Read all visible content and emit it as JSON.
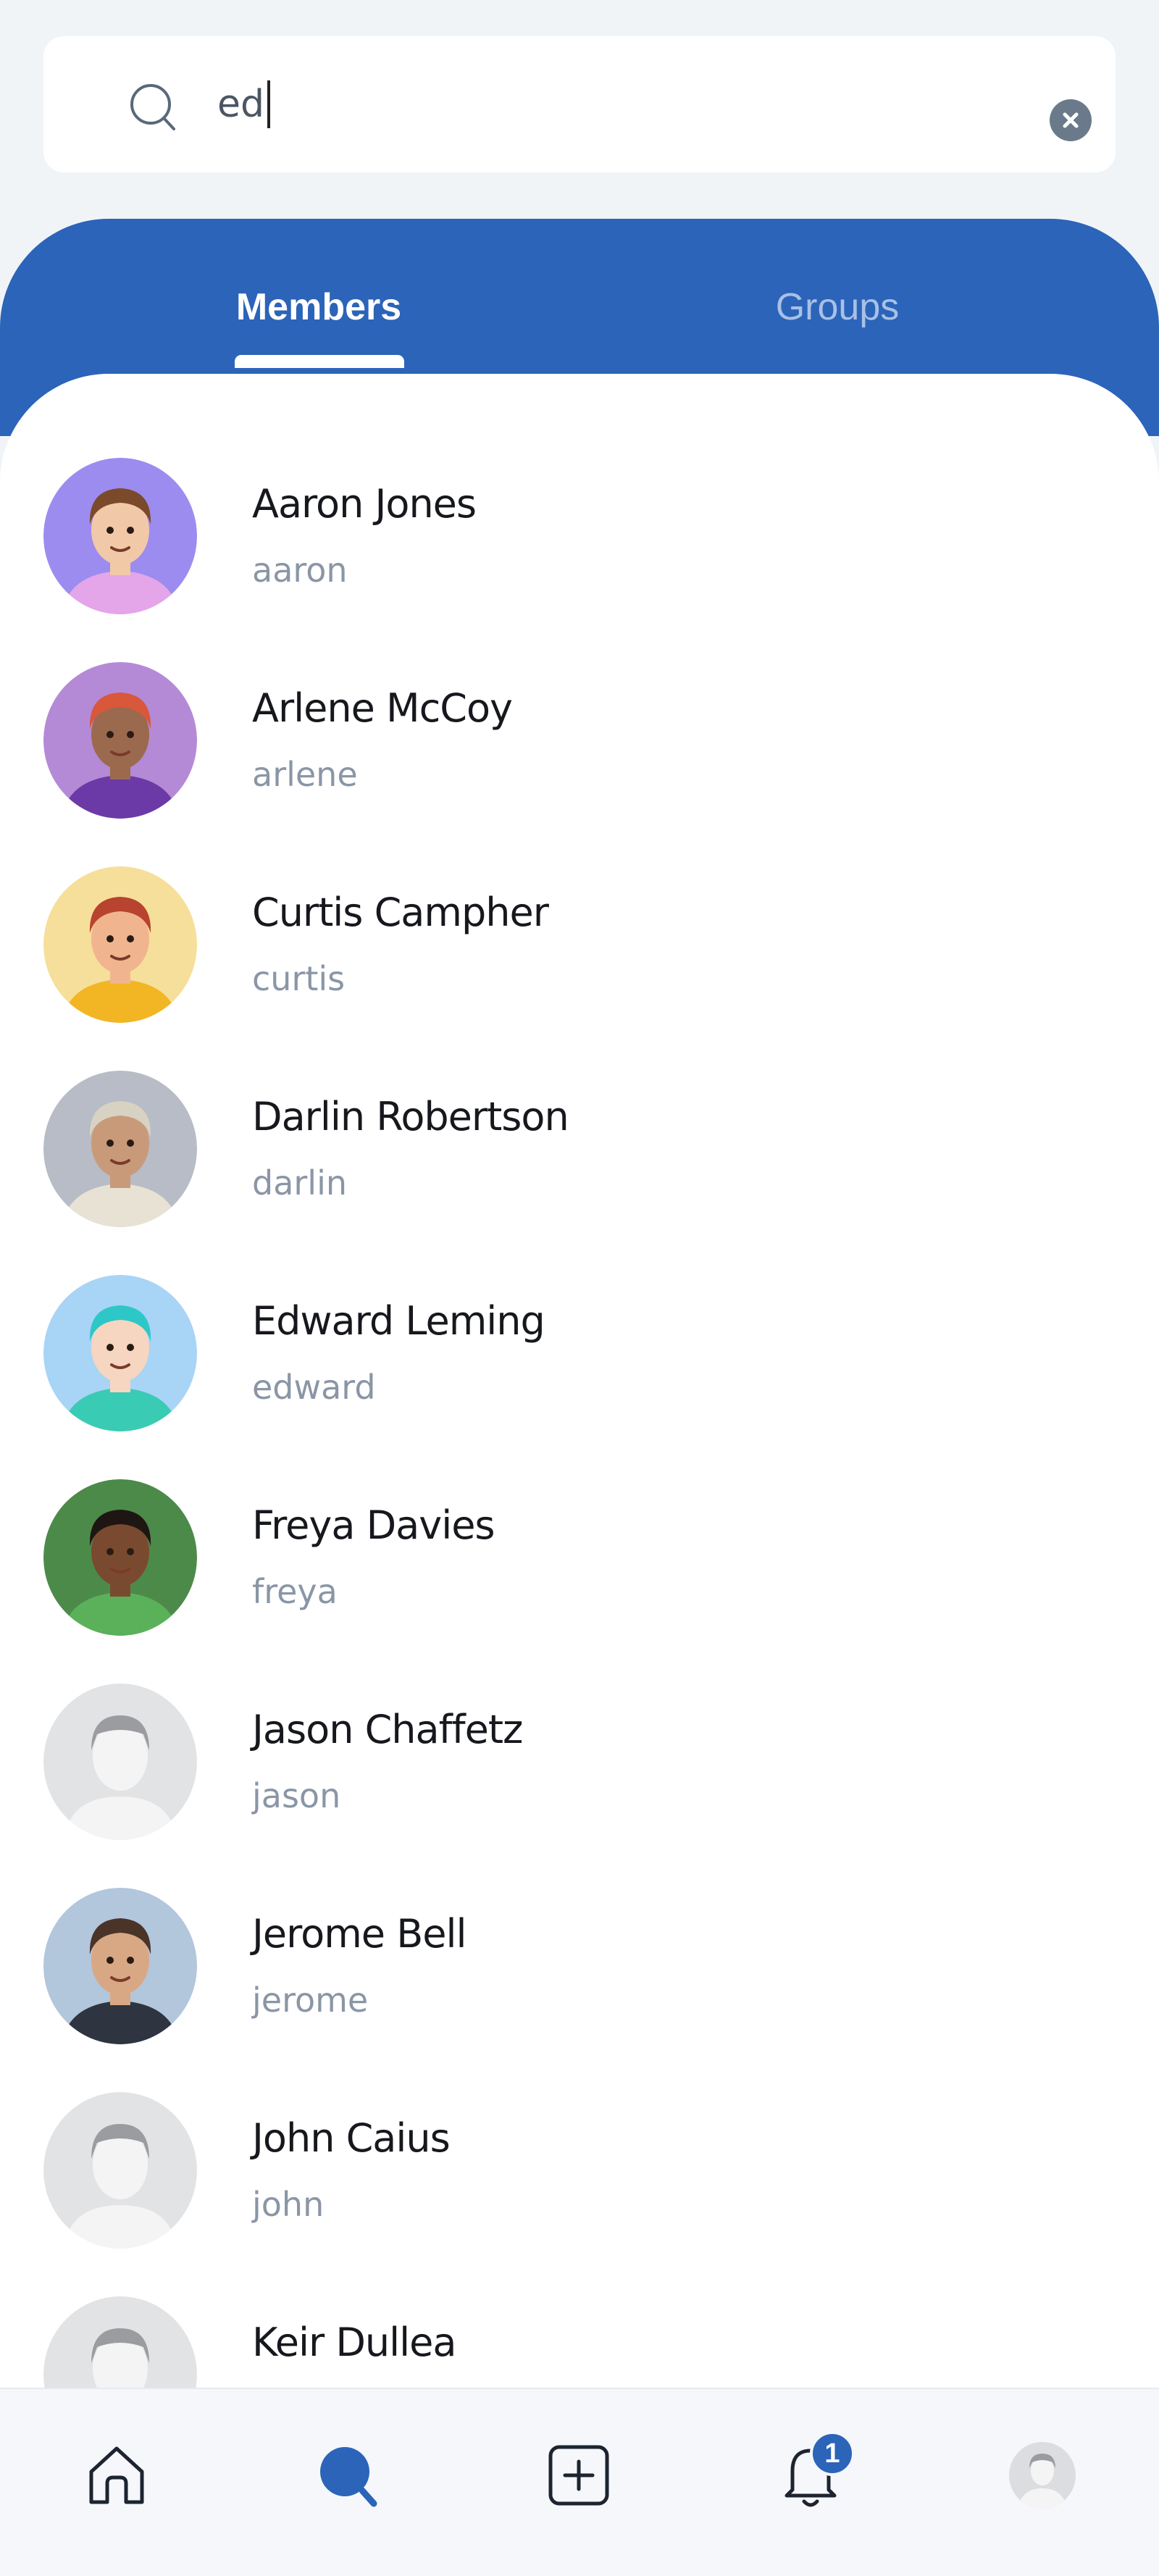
{
  "search": {
    "value": "ed",
    "clear_label": "clear search"
  },
  "tabs": [
    {
      "label": "Members",
      "active": true
    },
    {
      "label": "Groups",
      "active": false
    }
  ],
  "members": [
    {
      "name": "Aaron Jones",
      "username": "aaron",
      "avatar": "cartoon-boy-pink-hoodie",
      "bg": "#9c8cf0"
    },
    {
      "name": "Arlene McCoy",
      "username": "arlene",
      "avatar": "cartoon-man-red-cap",
      "bg": "#b48ad6"
    },
    {
      "name": "Curtis Campher",
      "username": "curtis",
      "avatar": "cartoon-curly-hair-glasses",
      "bg": "#f6df9a"
    },
    {
      "name": "Darlin Robertson",
      "username": "darlin",
      "avatar": "cartoon-man-hat",
      "bg": "#b7bcc6"
    },
    {
      "name": "Edward Leming",
      "username": "edward",
      "avatar": "cartoon-teal-hair",
      "bg": "#a8d4f6"
    },
    {
      "name": "Freya Davies",
      "username": "freya",
      "avatar": "cartoon-woman-green",
      "bg": "#4c8a4a"
    },
    {
      "name": "Jason Chaffetz",
      "username": "jason",
      "avatar": "default-placeholder",
      "bg": "#e2e3e5"
    },
    {
      "name": "Jerome Bell",
      "username": "jerome",
      "avatar": "cartoon-man-beard-suit",
      "bg": "#b2c6dc"
    },
    {
      "name": "John Caius",
      "username": "john",
      "avatar": "default-placeholder",
      "bg": "#e2e3e5"
    },
    {
      "name": "Keir Dullea",
      "username": "",
      "avatar": "default-placeholder",
      "bg": "#e2e3e5"
    }
  ],
  "nav": {
    "items": [
      {
        "icon": "home-icon"
      },
      {
        "icon": "search-icon",
        "active": true
      },
      {
        "icon": "add-post-icon"
      },
      {
        "icon": "notifications-icon",
        "badge": "1"
      },
      {
        "icon": "profile-avatar-icon"
      }
    ]
  },
  "colors": {
    "accent": "#2b64b9",
    "background": "#f1f4f7",
    "text_primary": "#16181d",
    "text_secondary": "#8a96a6"
  }
}
